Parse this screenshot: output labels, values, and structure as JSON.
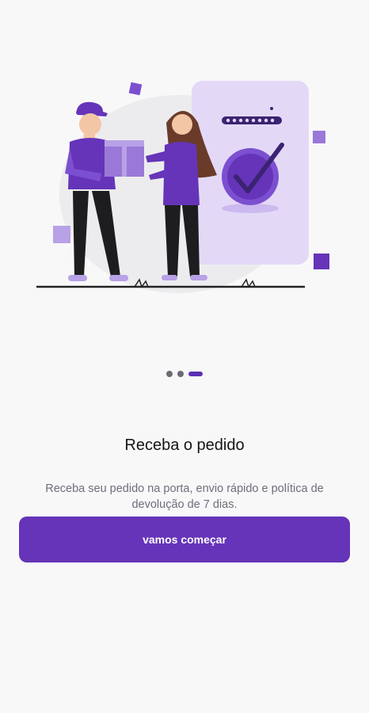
{
  "onboarding": {
    "title": "Receba o pedido",
    "description": "Receba seu pedido na porta, envio rápido e política de devolução de 7 dias.",
    "cta_label": "vamos começar",
    "pager": {
      "total_pages": 3,
      "current_page": 3
    }
  },
  "colors": {
    "accent": "#6534b8",
    "accent_light": "#e3d9f7",
    "background": "#f8f8f9",
    "title": "#151515",
    "description": "#6e6e78"
  },
  "icons": [
    "check-circle-icon",
    "delivery-illustration"
  ]
}
